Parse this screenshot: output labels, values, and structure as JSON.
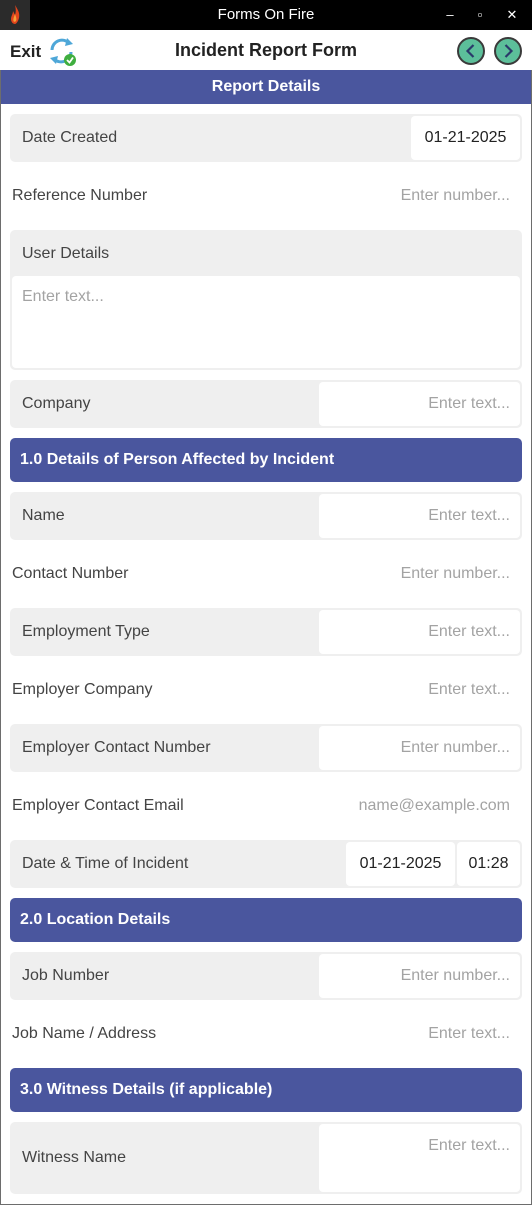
{
  "window": {
    "title": "Forms On Fire",
    "minimize": "–",
    "maximize": "▫",
    "close": "✕"
  },
  "toolbar": {
    "exit_label": "Exit",
    "form_title": "Incident Report Form"
  },
  "colors": {
    "header": "#4a569e",
    "row_bg": "#efefef",
    "nav_accent": "#5cbf9a"
  },
  "report_details": {
    "header": "Report Details",
    "date_created": {
      "label": "Date Created",
      "value": "01-21-2025"
    },
    "reference_number": {
      "label": "Reference Number",
      "placeholder": "Enter number..."
    },
    "user_details": {
      "label": "User Details",
      "placeholder": "Enter text..."
    },
    "company": {
      "label": "Company",
      "placeholder": "Enter text..."
    }
  },
  "section1": {
    "header": "1.0 Details of Person Affected by Incident",
    "name": {
      "label": "Name",
      "placeholder": "Enter text..."
    },
    "contact_number": {
      "label": "Contact Number",
      "placeholder": "Enter number..."
    },
    "employment_type": {
      "label": "Employment Type",
      "placeholder": "Enter text..."
    },
    "employer_company": {
      "label": "Employer Company",
      "placeholder": "Enter text..."
    },
    "employer_contact_number": {
      "label": "Employer Contact Number",
      "placeholder": "Enter number..."
    },
    "employer_contact_email": {
      "label": "Employer Contact Email",
      "placeholder": "name@example.com"
    },
    "incident_datetime": {
      "label": "Date & Time of Incident",
      "date": "01-21-2025",
      "time": "01:28"
    }
  },
  "section2": {
    "header": "2.0 Location Details",
    "job_number": {
      "label": "Job Number",
      "placeholder": "Enter number..."
    },
    "job_name_address": {
      "label": "Job Name / Address",
      "placeholder": "Enter text..."
    }
  },
  "section3": {
    "header": "3.0 Witness Details (if applicable)",
    "witness_name": {
      "label": "Witness Name",
      "placeholder": "Enter text..."
    }
  }
}
